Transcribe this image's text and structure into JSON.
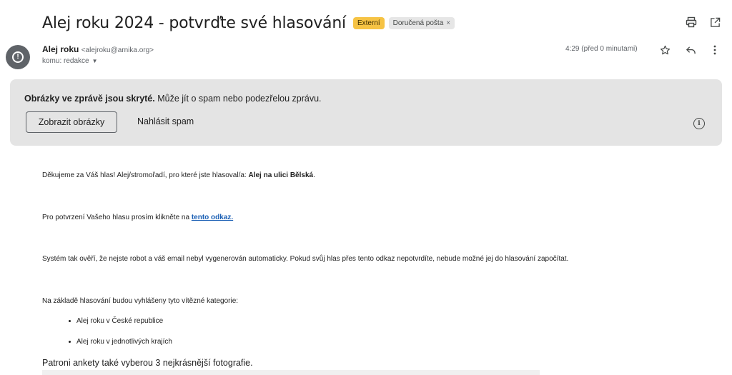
{
  "subject": {
    "title": "Alej roku 2024 - potvrďte své hlasování",
    "external_label": "Externí",
    "inbox_label": "Doručená pošta",
    "inbox_remove": "×"
  },
  "toolbar_icons": [
    "print-icon",
    "open-in-new-window-icon"
  ],
  "sender": {
    "name": "Alej roku",
    "email": "<alejroku@arnika.org>",
    "recipient": "komu: redakce",
    "time": "4:29 (před 0 minutami)"
  },
  "warning": {
    "bold_text": "Obrázky ve zprávě jsou skryté.",
    "text": " Může jít o spam nebo podezřelou zprávu.",
    "show_images": "Zobrazit obrázky",
    "report_spam": "Nahlásit spam"
  },
  "body": {
    "line1_prefix": "Děkujeme za Váš hlas! Alej/stromořadí, pro které jste hlasoval/a: ",
    "line1_bold": "Alej na ulici Bělská",
    "line1_suffix": ".",
    "line2_prefix": "Pro potvrzení Vašeho hlasu prosím klikněte na ",
    "line2_link": "tento odkaz.",
    "line3": "Systém tak ověří, že nejste robot a váš email nebyl vygenerován automaticky. Pokud svůj hlas přes tento odkaz nepotvrdíte, nebude možné jej do hlasování započítat.",
    "line4": "Na základě hlasování budou vyhlášeny tyto vítězné kategorie:",
    "bullets": [
      "Alej roku v České republice",
      "Alej roku v jednotlivých krajích"
    ],
    "footer": "Patroni ankety také vyberou 3 nejkrásnější fotografie."
  }
}
